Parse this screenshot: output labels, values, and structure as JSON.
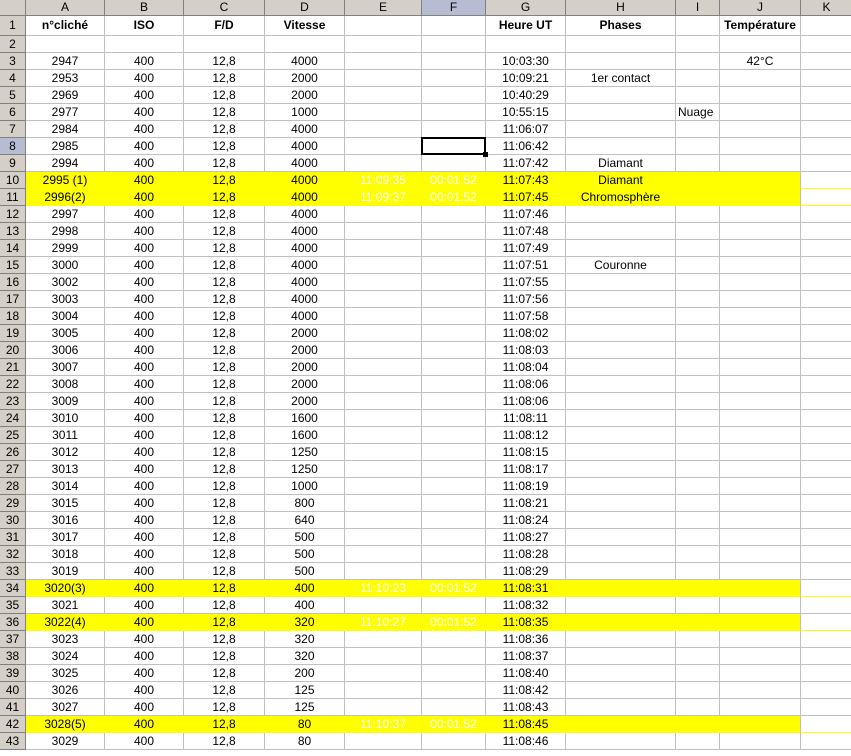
{
  "columns": [
    "A",
    "B",
    "C",
    "D",
    "E",
    "F",
    "G",
    "H",
    "I",
    "J",
    "K"
  ],
  "selected_column": "F",
  "selected_row": 8,
  "rows": [
    {
      "n": 1,
      "cells": [
        "n°cliché",
        "ISO",
        "F/D",
        "Vitesse",
        "",
        "",
        "Heure UT",
        "Phases",
        "",
        "Température",
        ""
      ],
      "header": true
    },
    {
      "n": 2,
      "cells": [
        "",
        "",
        "",
        "",
        "",
        "",
        "",
        "",
        "",
        "",
        ""
      ]
    },
    {
      "n": 3,
      "cells": [
        "2947",
        "400",
        "12,8",
        "4000",
        "",
        "",
        "10:03:30",
        "",
        "",
        "42°C",
        ""
      ]
    },
    {
      "n": 4,
      "cells": [
        "2953",
        "400",
        "12,8",
        "2000",
        "",
        "",
        "10:09:21",
        "1er contact",
        "",
        "",
        ""
      ]
    },
    {
      "n": 5,
      "cells": [
        "2969",
        "400",
        "12,8",
        "2000",
        "",
        "",
        "10:40:29",
        "",
        "",
        "",
        ""
      ]
    },
    {
      "n": 6,
      "cells": [
        "2977",
        "400",
        "12,8",
        "1000",
        "",
        "",
        "10:55:15",
        "",
        "Nuage",
        "",
        ""
      ]
    },
    {
      "n": 7,
      "cells": [
        "2984",
        "400",
        "12,8",
        "4000",
        "",
        "",
        "11:06:07",
        "",
        "",
        "",
        ""
      ]
    },
    {
      "n": 8,
      "cells": [
        "2985",
        "400",
        "12,8",
        "4000",
        "",
        "",
        "11:06:42",
        "",
        "",
        "",
        ""
      ]
    },
    {
      "n": 9,
      "cells": [
        "2994",
        "400",
        "12,8",
        "4000",
        "",
        "",
        "11:07:42",
        "Diamant",
        "",
        "",
        ""
      ]
    },
    {
      "n": 10,
      "cells": [
        "2995 (1)",
        "400",
        "12,8",
        "4000",
        "11:09:35",
        "00:01:52",
        "11:07:43",
        "Diamant",
        "",
        "",
        ""
      ],
      "hl": true
    },
    {
      "n": 11,
      "cells": [
        "2996(2)",
        "400",
        "12,8",
        "4000",
        "11:09:37",
        "00:01:52",
        "11:07:45",
        "Chromosphère",
        "",
        "",
        ""
      ],
      "hl": true
    },
    {
      "n": 12,
      "cells": [
        "2997",
        "400",
        "12,8",
        "4000",
        "",
        "",
        "11:07:46",
        "",
        "",
        "",
        ""
      ]
    },
    {
      "n": 13,
      "cells": [
        "2998",
        "400",
        "12,8",
        "4000",
        "",
        "",
        "11:07:48",
        "",
        "",
        "",
        ""
      ]
    },
    {
      "n": 14,
      "cells": [
        "2999",
        "400",
        "12,8",
        "4000",
        "",
        "",
        "11:07:49",
        "",
        "",
        "",
        ""
      ]
    },
    {
      "n": 15,
      "cells": [
        "3000",
        "400",
        "12,8",
        "4000",
        "",
        "",
        "11:07:51",
        "Couronne",
        "",
        "",
        ""
      ]
    },
    {
      "n": 16,
      "cells": [
        "3002",
        "400",
        "12,8",
        "4000",
        "",
        "",
        "11:07:55",
        "",
        "",
        "",
        ""
      ]
    },
    {
      "n": 17,
      "cells": [
        "3003",
        "400",
        "12,8",
        "4000",
        "",
        "",
        "11:07:56",
        "",
        "",
        "",
        ""
      ]
    },
    {
      "n": 18,
      "cells": [
        "3004",
        "400",
        "12,8",
        "4000",
        "",
        "",
        "11:07:58",
        "",
        "",
        "",
        ""
      ]
    },
    {
      "n": 19,
      "cells": [
        "3005",
        "400",
        "12,8",
        "2000",
        "",
        "",
        "11:08:02",
        "",
        "",
        "",
        ""
      ]
    },
    {
      "n": 20,
      "cells": [
        "3006",
        "400",
        "12,8",
        "2000",
        "",
        "",
        "11:08:03",
        "",
        "",
        "",
        ""
      ]
    },
    {
      "n": 21,
      "cells": [
        "3007",
        "400",
        "12,8",
        "2000",
        "",
        "",
        "11:08:04",
        "",
        "",
        "",
        ""
      ]
    },
    {
      "n": 22,
      "cells": [
        "3008",
        "400",
        "12,8",
        "2000",
        "",
        "",
        "11:08:06",
        "",
        "",
        "",
        ""
      ]
    },
    {
      "n": 23,
      "cells": [
        "3009",
        "400",
        "12,8",
        "2000",
        "",
        "",
        "11:08:06",
        "",
        "",
        "",
        ""
      ]
    },
    {
      "n": 24,
      "cells": [
        "3010",
        "400",
        "12,8",
        "1600",
        "",
        "",
        "11:08:11",
        "",
        "",
        "",
        ""
      ]
    },
    {
      "n": 25,
      "cells": [
        "3011",
        "400",
        "12,8",
        "1600",
        "",
        "",
        "11:08:12",
        "",
        "",
        "",
        ""
      ]
    },
    {
      "n": 26,
      "cells": [
        "3012",
        "400",
        "12,8",
        "1250",
        "",
        "",
        "11:08:15",
        "",
        "",
        "",
        ""
      ]
    },
    {
      "n": 27,
      "cells": [
        "3013",
        "400",
        "12,8",
        "1250",
        "",
        "",
        "11:08:17",
        "",
        "",
        "",
        ""
      ]
    },
    {
      "n": 28,
      "cells": [
        "3014",
        "400",
        "12,8",
        "1000",
        "",
        "",
        "11:08:19",
        "",
        "",
        "",
        ""
      ]
    },
    {
      "n": 29,
      "cells": [
        "3015",
        "400",
        "12,8",
        "800",
        "",
        "",
        "11:08:21",
        "",
        "",
        "",
        ""
      ]
    },
    {
      "n": 30,
      "cells": [
        "3016",
        "400",
        "12,8",
        "640",
        "",
        "",
        "11:08:24",
        "",
        "",
        "",
        ""
      ]
    },
    {
      "n": 31,
      "cells": [
        "3017",
        "400",
        "12,8",
        "500",
        "",
        "",
        "11:08:27",
        "",
        "",
        "",
        ""
      ]
    },
    {
      "n": 32,
      "cells": [
        "3018",
        "400",
        "12,8",
        "500",
        "",
        "",
        "11:08:28",
        "",
        "",
        "",
        ""
      ]
    },
    {
      "n": 33,
      "cells": [
        "3019",
        "400",
        "12,8",
        "500",
        "",
        "",
        "11:08:29",
        "",
        "",
        "",
        ""
      ]
    },
    {
      "n": 34,
      "cells": [
        "3020(3)",
        "400",
        "12,8",
        "400",
        "11:10:23",
        "00:01:52",
        "11:08:31",
        "",
        "",
        "",
        ""
      ],
      "hl": true
    },
    {
      "n": 35,
      "cells": [
        "3021",
        "400",
        "12,8",
        "400",
        "",
        "",
        "11:08:32",
        "",
        "",
        "",
        ""
      ]
    },
    {
      "n": 36,
      "cells": [
        "3022(4)",
        "400",
        "12,8",
        "320",
        "11:10:27",
        "00:01:52",
        "11:08:35",
        "",
        "",
        "",
        ""
      ],
      "hl": true
    },
    {
      "n": 37,
      "cells": [
        "3023",
        "400",
        "12,8",
        "320",
        "",
        "",
        "11:08:36",
        "",
        "",
        "",
        ""
      ]
    },
    {
      "n": 38,
      "cells": [
        "3024",
        "400",
        "12,8",
        "320",
        "",
        "",
        "11:08:37",
        "",
        "",
        "",
        ""
      ]
    },
    {
      "n": 39,
      "cells": [
        "3025",
        "400",
        "12,8",
        "200",
        "",
        "",
        "11:08:40",
        "",
        "",
        "",
        ""
      ]
    },
    {
      "n": 40,
      "cells": [
        "3026",
        "400",
        "12,8",
        "125",
        "",
        "",
        "11:08:42",
        "",
        "",
        "",
        ""
      ]
    },
    {
      "n": 41,
      "cells": [
        "3027",
        "400",
        "12,8",
        "125",
        "",
        "",
        "11:08:43",
        "",
        "",
        "",
        ""
      ]
    },
    {
      "n": 42,
      "cells": [
        "3028(5)",
        "400",
        "12,8",
        "80",
        "11:10:37",
        "00:01:52",
        "11:08:45",
        "",
        "",
        "",
        ""
      ],
      "hl": true
    },
    {
      "n": 43,
      "cells": [
        "3029",
        "400",
        "12,8",
        "80",
        "",
        "",
        "11:08:46",
        "",
        "",
        "",
        ""
      ]
    }
  ]
}
